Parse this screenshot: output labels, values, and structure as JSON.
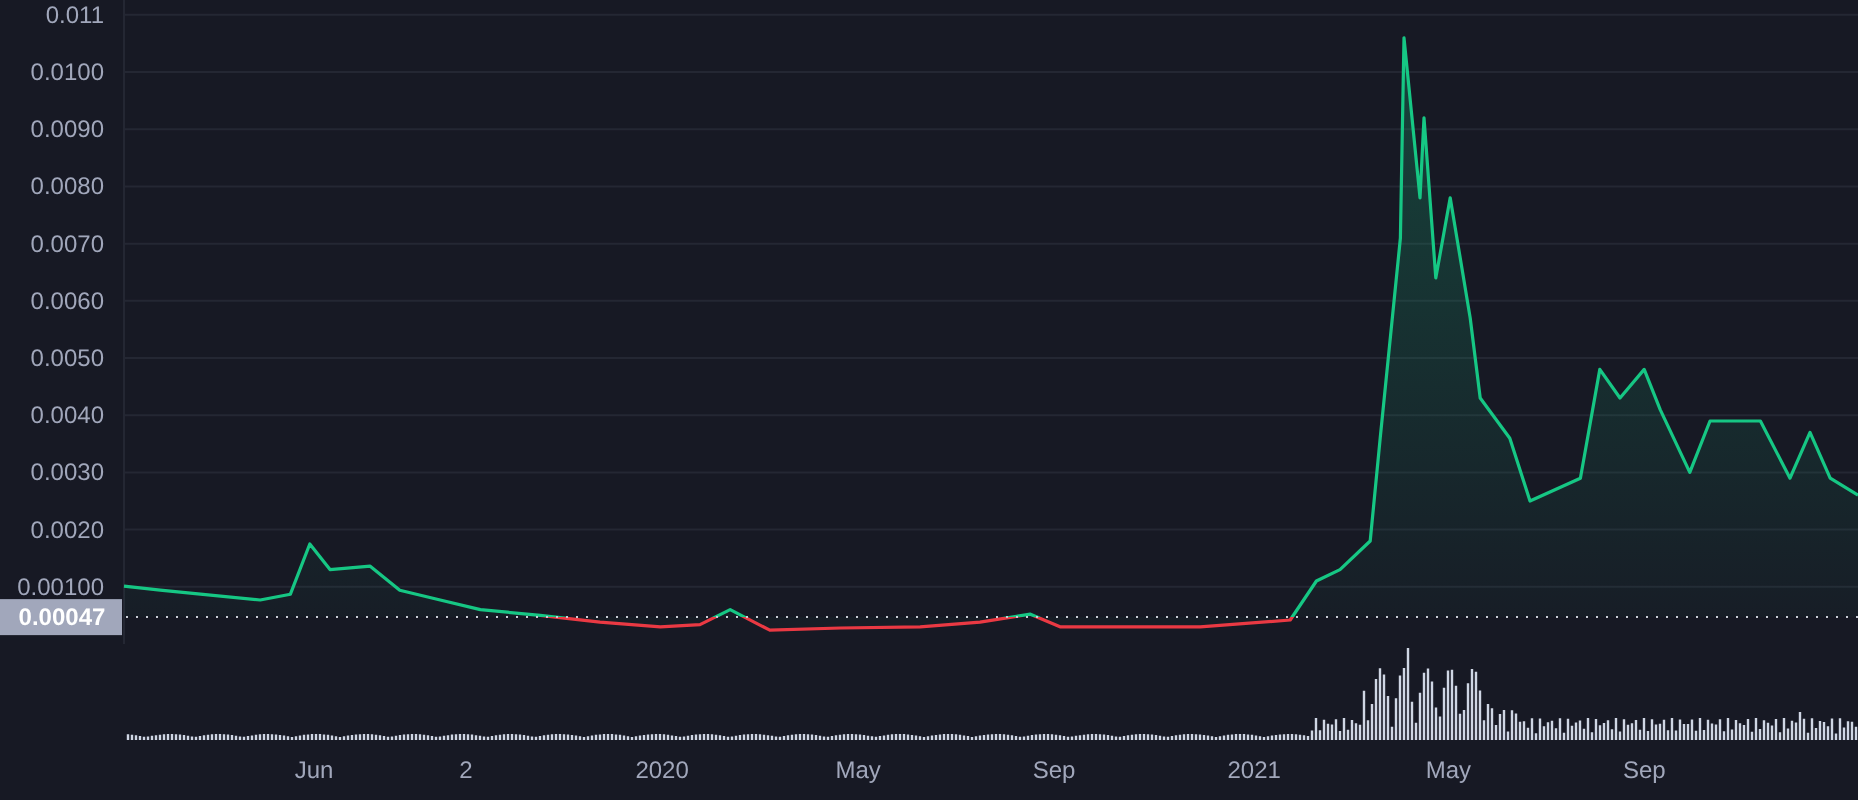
{
  "chart_data": {
    "type": "area",
    "grid": true,
    "xlim": [
      2019.091,
      2022.02
    ],
    "ylim": [
      0,
      0.01126
    ],
    "yticks": [
      {
        "value": 0.001,
        "label": "0.00100"
      },
      {
        "value": 0.002,
        "label": "0.0020"
      },
      {
        "value": 0.003,
        "label": "0.0030"
      },
      {
        "value": 0.004,
        "label": "0.0040"
      },
      {
        "value": 0.005,
        "label": "0.0050"
      },
      {
        "value": 0.006,
        "label": "0.0060"
      },
      {
        "value": 0.007,
        "label": "0.0070"
      },
      {
        "value": 0.008,
        "label": "0.0080"
      },
      {
        "value": 0.009,
        "label": "0.0090"
      },
      {
        "value": 0.01,
        "label": "0.0100"
      },
      {
        "value": 0.011,
        "label": "0.011"
      }
    ],
    "xticks": [
      {
        "value": 2019.412,
        "label": "Jun"
      },
      {
        "value": 2020,
        "label": "2020"
      },
      {
        "value": 2020.331,
        "label": "May"
      },
      {
        "value": 2020.662,
        "label": "Sep"
      },
      {
        "value": 2021,
        "label": "2021"
      },
      {
        "value": 2021.328,
        "label": "May"
      },
      {
        "value": 2021.659,
        "label": "Sep"
      }
    ],
    "x": [
      2019.091,
      2019.152,
      2019.22,
      2019.321,
      2019.372,
      2019.405,
      2019.439,
      2019.507,
      2019.557,
      2019.625,
      2019.693,
      2019.794,
      2019.895,
      2019.997,
      2020.064,
      2020.115,
      2020.182,
      2020.301,
      2020.436,
      2020.537,
      2020.622,
      2020.672,
      2020.774,
      2020.909,
      2021.061,
      2021.105,
      2021.145,
      2021.196,
      2021.213,
      2021.247,
      2021.253,
      2021.28,
      2021.287,
      2021.307,
      2021.331,
      2021.365,
      2021.382,
      2021.432,
      2021.466,
      2021.551,
      2021.584,
      2021.618,
      2021.659,
      2021.686,
      2021.736,
      2021.77,
      2021.855,
      2021.905,
      2021.939,
      2021.973,
      2022.02
    ],
    "series": [
      {
        "color": "#16c784",
        "values": [
          0.00101,
          0.00094,
          0.00087,
          0.00077,
          0.00087,
          0.00175,
          0.0013,
          0.00136,
          0.00094,
          0.00077,
          0.0006,
          0.0005,
          0.00038,
          0.0003,
          0.00034,
          0.0006,
          0.00024,
          0.00028,
          0.0003,
          0.00038,
          0.00052,
          0.0003,
          0.0003,
          0.0003,
          0.00042,
          0.0011,
          0.0013,
          0.0018,
          0.0036,
          0.0071,
          0.0106,
          0.0078,
          0.0092,
          0.0064,
          0.0078,
          0.0057,
          0.0043,
          0.0036,
          0.0025,
          0.0029,
          0.0048,
          0.0043,
          0.0048,
          0.0041,
          0.003,
          0.0039,
          0.0039,
          0.0029,
          0.0037,
          0.0029,
          0.0026
        ]
      }
    ],
    "ref_lines": [
      {
        "axis": "y",
        "value": 0.00047,
        "label": "0.00047"
      }
    ]
  },
  "extra_axis_label": "2"
}
